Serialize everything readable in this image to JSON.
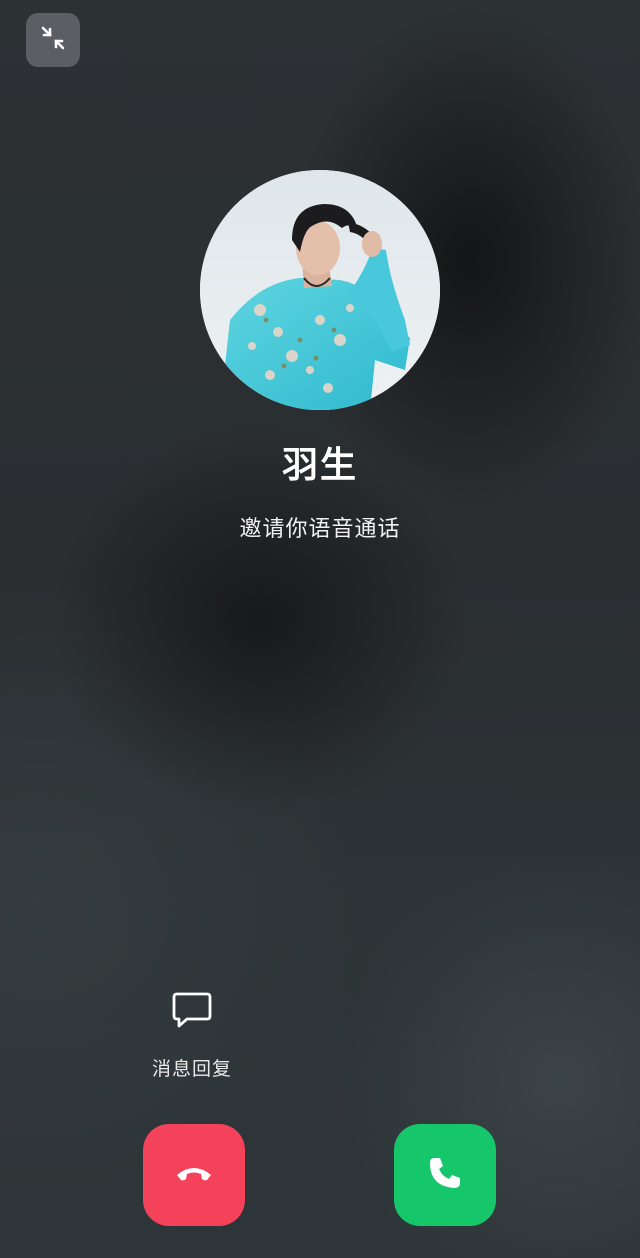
{
  "caller": {
    "name": "羽生",
    "status": "邀请你语音通话"
  },
  "actions": {
    "message_reply_label": "消息回复"
  },
  "icons": {
    "minimize": "minimize-arrows-icon",
    "message": "chat-bubble-icon",
    "decline": "hang-up-phone-icon",
    "accept": "phone-icon"
  },
  "colors": {
    "decline": "#f4425a",
    "accept": "#16c66b",
    "minimize_bg": "#5b5f63"
  }
}
